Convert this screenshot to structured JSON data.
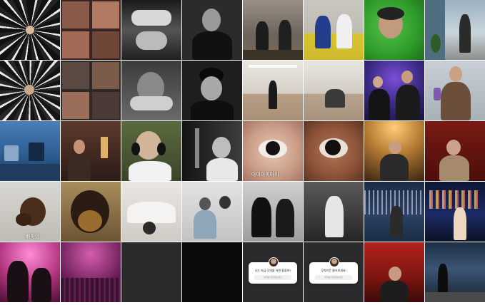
{
  "feed": {
    "captions": {
      "eye": "아이아이아이",
      "dog": "빠마앙"
    },
    "question_stickers": [
      {
        "question": "나는 지금 무엇을 하면 좋을까?",
        "placeholder": "여러분 답변해보세요"
      },
      {
        "question": "무엇이든 물어보세요!",
        "placeholder": "여러분 답변해보세요"
      }
    ]
  }
}
